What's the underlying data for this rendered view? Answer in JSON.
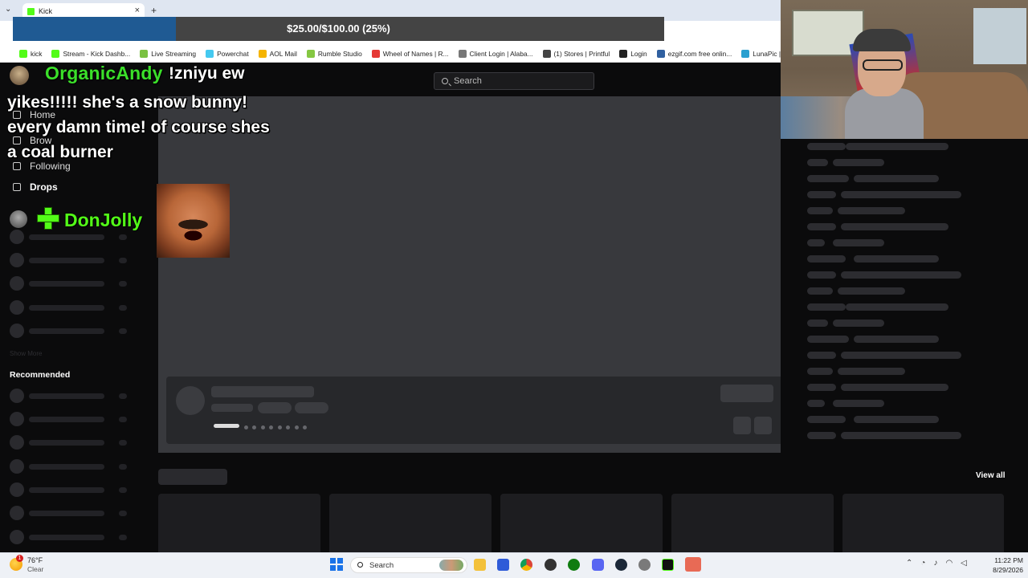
{
  "browser": {
    "tab_title": "Kick",
    "new_tab": "+",
    "close_tab": "×",
    "tab_dropdown": "⌄",
    "bookmarks": [
      {
        "label": "kick",
        "color": "#53fc18"
      },
      {
        "label": "Stream - Kick Dashb...",
        "color": "#53fc18"
      },
      {
        "label": "Live Streaming",
        "color": "#7ac142"
      },
      {
        "label": "Powerchat",
        "color": "#45c9f0"
      },
      {
        "label": "AOL Mail",
        "color": "#f5b400"
      },
      {
        "label": "Rumble Studio",
        "color": "#85c742"
      },
      {
        "label": "Wheel of Names | R...",
        "color": "#e53935"
      },
      {
        "label": "Client Login | Alaba...",
        "color": "#777777"
      },
      {
        "label": "(1) Stores | Printful",
        "color": "#444444"
      },
      {
        "label": "Login",
        "color": "#222222"
      },
      {
        "label": "ezgif.com free onlin...",
        "color": "#3060a0"
      },
      {
        "label": "LunaPic | Free O",
        "color": "#2aa0d0"
      }
    ]
  },
  "donation_goal": {
    "text": "$25.00/$100.00 (25%)",
    "progress": 0.25,
    "fill_color": "#1f5a93"
  },
  "kick": {
    "search_placeholder": "Search",
    "nav": {
      "home": "Home",
      "browse": "Brow",
      "following": "Following",
      "drops": "Drops"
    },
    "show_more": "Show More",
    "recommended": "Recommended",
    "view_all": "View all"
  },
  "overlay": {
    "chat_username": "OrganicAndy",
    "chat_user_msg": "!zniyu ew",
    "chat_message": "yikes!!!!! she's a snow bunny! every damn time! of course shes a coal burner",
    "donor_name": "DonJolly",
    "brand_color": "#53fc18"
  },
  "taskbar": {
    "weather_temp": "76°F",
    "weather_cond": "Clear",
    "weather_badge": "1",
    "search_label": "Search",
    "time": "11:22 PM",
    "date": "8/29/2026"
  }
}
